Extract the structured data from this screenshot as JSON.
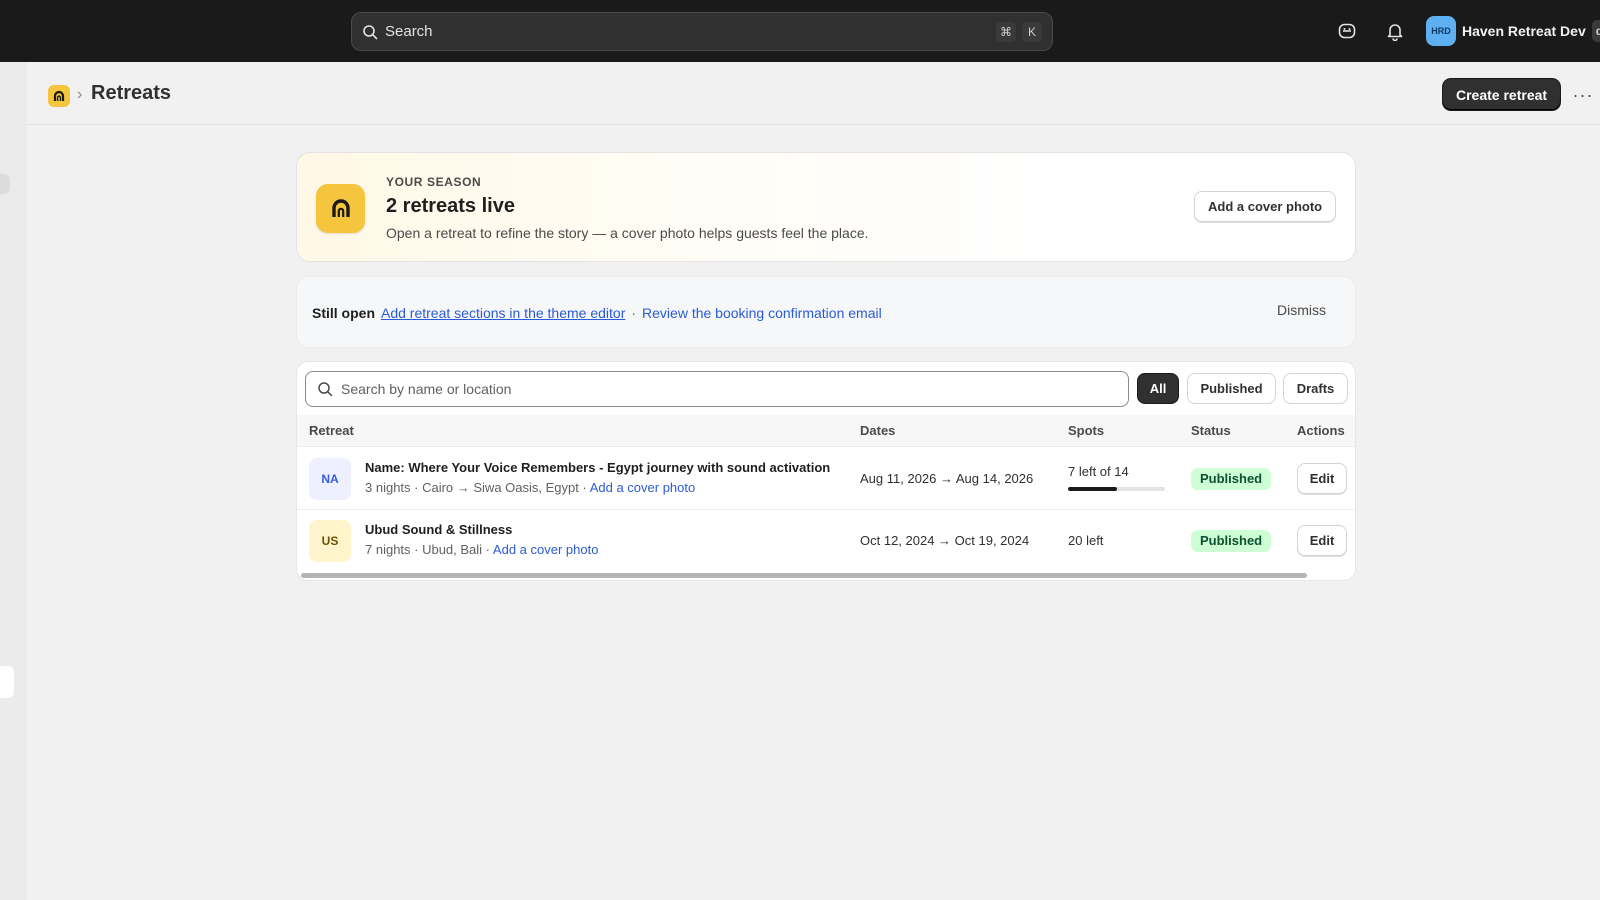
{
  "topbar": {
    "search_placeholder": "Search",
    "shortcut_keys": [
      "⌘",
      "K"
    ],
    "user_initials": "HRD",
    "user_name": "Haven Retreat Dev",
    "user_extra": "d"
  },
  "header": {
    "title": "Retreats",
    "create_button": "Create retreat",
    "more_label": "···"
  },
  "season": {
    "eyebrow": "YOUR SEASON",
    "title": "2 retreats live",
    "subtitle": "Open a retreat to refine the story — a cover photo helps guests feel the place.",
    "cover_button": "Add a cover photo"
  },
  "banner": {
    "label": "Still open",
    "link1": "Add retreat sections in the theme editor",
    "separator": "·",
    "link2": "Review the booking confirmation email",
    "dismiss": "Dismiss"
  },
  "table": {
    "search_placeholder": "Search by name or location",
    "filters": [
      "All",
      "Published",
      "Drafts"
    ],
    "columns": {
      "retreat": "Retreat",
      "dates": "Dates",
      "spots": "Spots",
      "status": "Status",
      "actions": "Actions"
    },
    "rows": [
      {
        "initials": "NA",
        "name": "Name: Where Your Voice Remembers - Egypt journey with sound activation",
        "meta": "3 nights · Cairo → Siwa Oasis, Egypt ·",
        "cover_link": "Add a cover photo",
        "dates": "Aug 11, 2026 → Aug 14, 2026",
        "spots": "7 left of 14",
        "spots_left_fraction": 0.5,
        "status": "Published",
        "action": "Edit"
      },
      {
        "initials": "US",
        "name": "Ubud Sound & Stillness",
        "meta": "7 nights · Ubud, Bali ·",
        "cover_link": "Add a cover photo",
        "dates": "Oct 12, 2024 → Oct 19, 2024",
        "spots": "20 left",
        "status": "Published",
        "action": "Edit"
      }
    ]
  },
  "colors": {
    "brand_yellow": "#f5c53d",
    "topbar": "#1a1a1a",
    "link_blue": "#2a5bd7",
    "published_bg": "#cdfed4",
    "published_text": "#0c5132",
    "na_badge_bg": "#eef0ff",
    "na_badge_text": "#3b5bdb",
    "us_badge_bg": "#fff4cc",
    "us_badge_text": "#6b5200"
  },
  "icons": [
    "search-icon",
    "shortcut-key-icons",
    "chat-icon",
    "bell-icon",
    "brand-logo-icon",
    "more-icon"
  ]
}
